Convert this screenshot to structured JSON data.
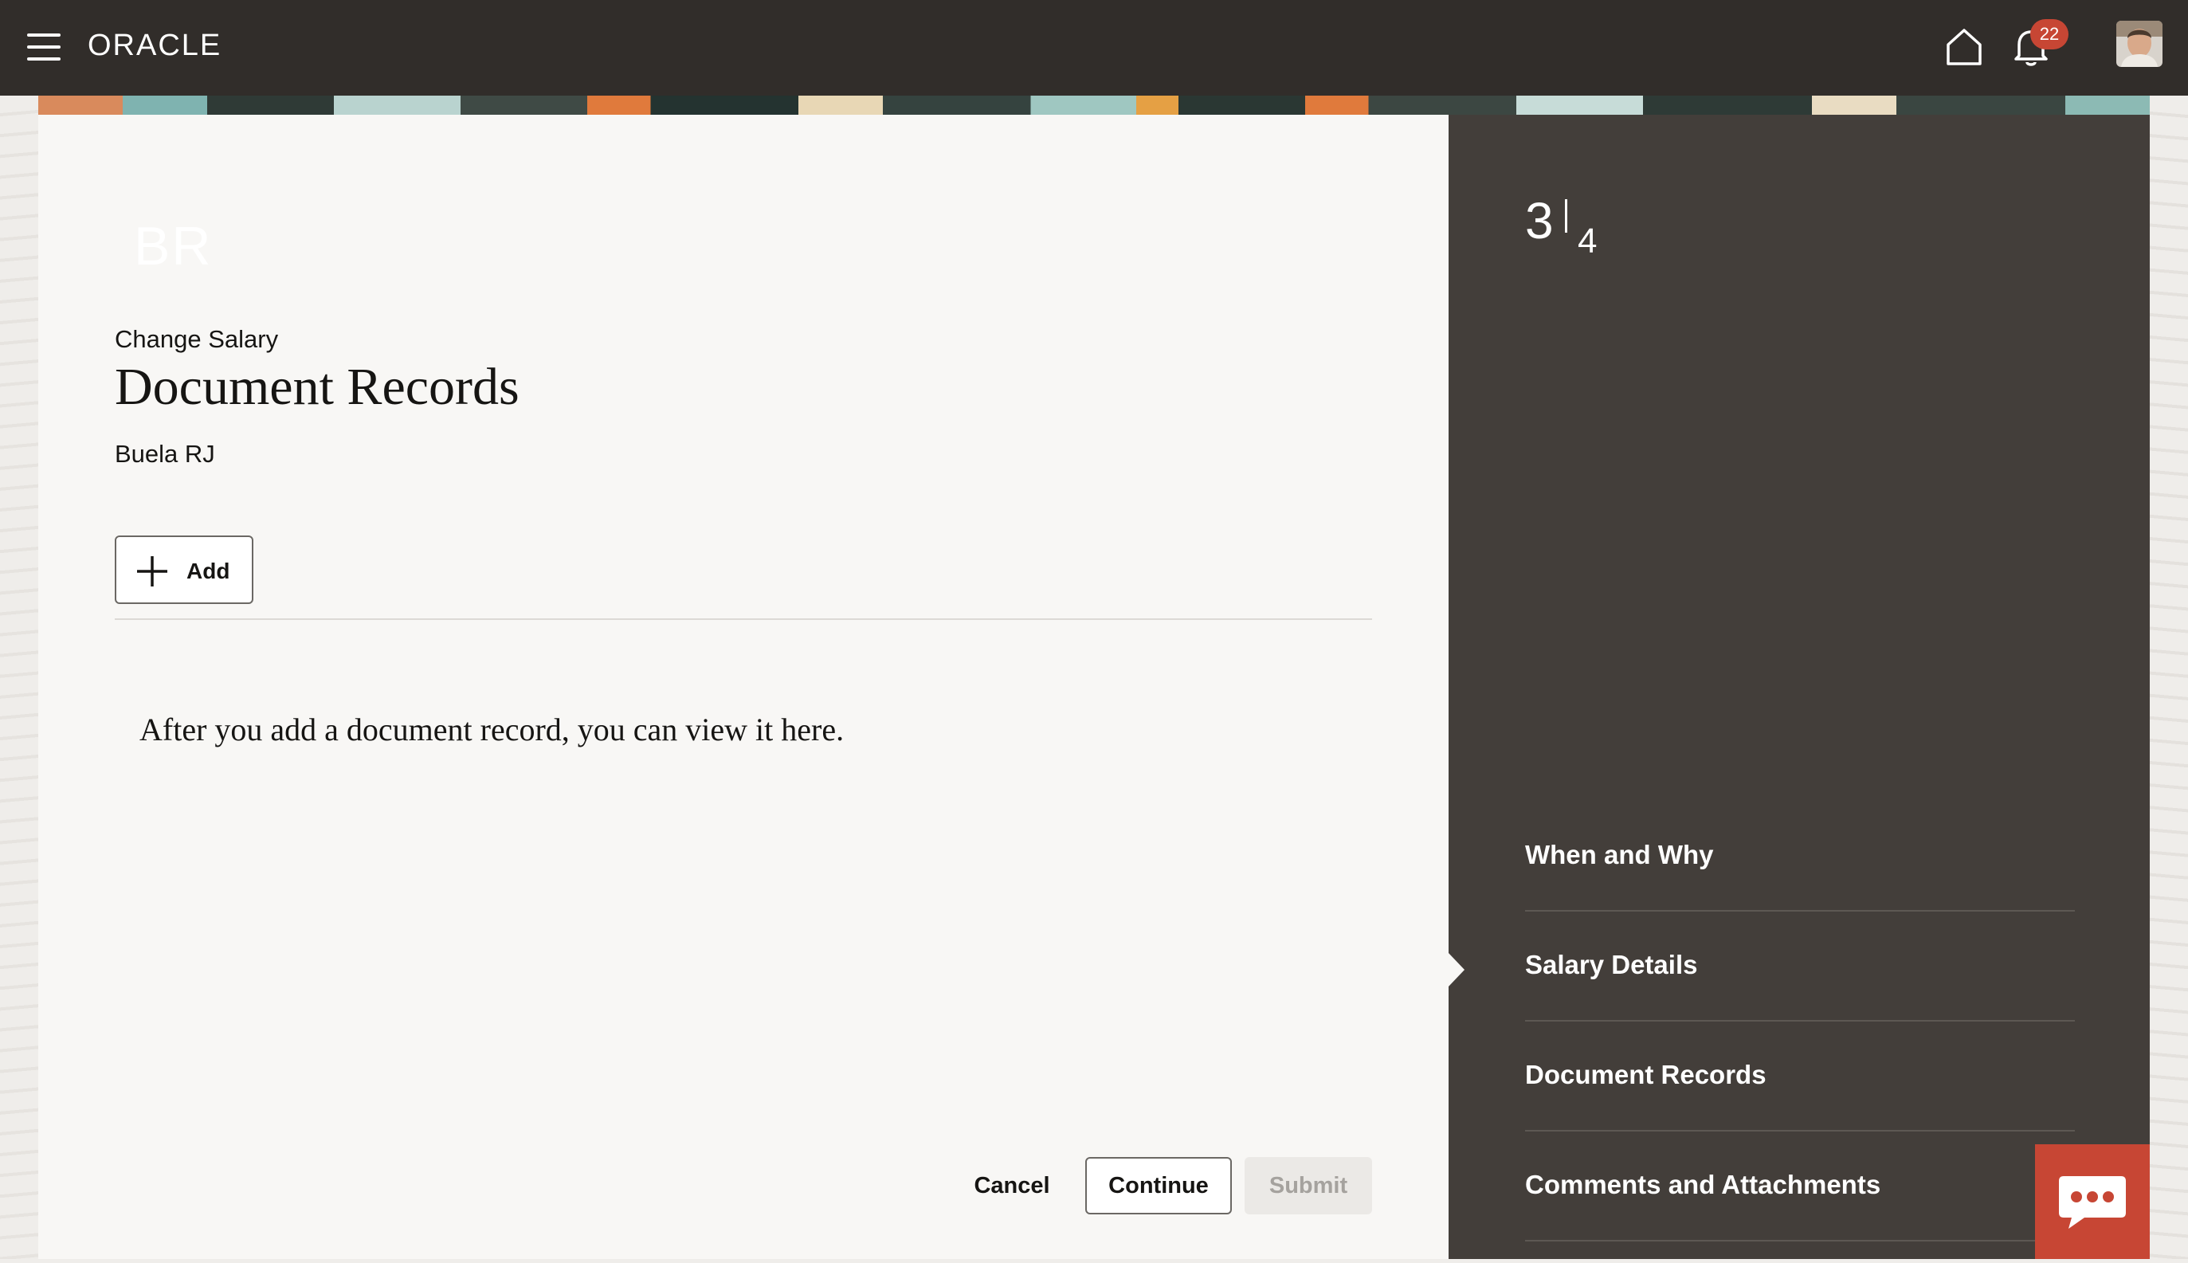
{
  "header": {
    "logo": "ORACLE",
    "notification_count": "22",
    "icons": [
      "menu-icon",
      "home-icon",
      "bell-icon"
    ]
  },
  "page": {
    "initials": "BR",
    "subtitle": "Change Salary",
    "title": "Document Records",
    "person_name": "Buela RJ",
    "add_label": "Add",
    "empty_message": "After you add a document record, you can view it here."
  },
  "actions": {
    "cancel": "Cancel",
    "continue": "Continue",
    "submit": "Submit"
  },
  "progress": {
    "current": "3",
    "total": "4"
  },
  "steps": [
    {
      "label": "When and Why"
    },
    {
      "label": "Salary Details"
    },
    {
      "label": "Document Records",
      "current": true
    },
    {
      "label": "Comments and Attachments"
    }
  ],
  "colors": {
    "header_bg": "#312d2a",
    "panel_bg": "#433e3a",
    "accent": "#c74634"
  }
}
